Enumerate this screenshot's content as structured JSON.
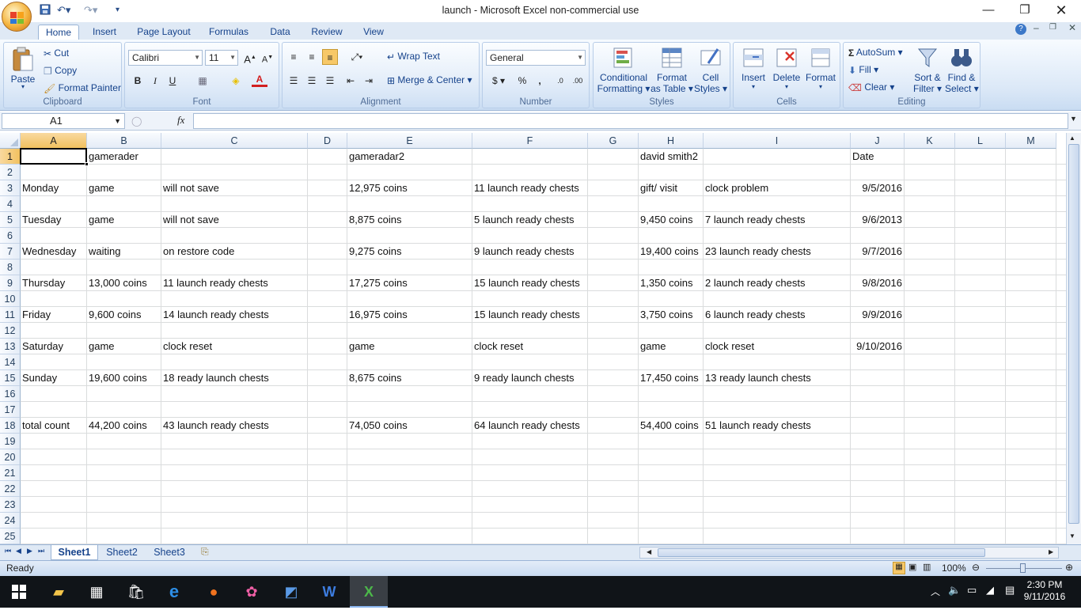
{
  "window": {
    "title": "launch - Microsoft Excel non-commercial use"
  },
  "ribbon": {
    "tabs": [
      "Home",
      "Insert",
      "Page Layout",
      "Formulas",
      "Data",
      "Review",
      "View"
    ],
    "clipboard": {
      "paste": "Paste",
      "cut": "Cut",
      "copy": "Copy",
      "format_painter": "Format Painter",
      "label": "Clipboard"
    },
    "font": {
      "name": "Calibri",
      "size": "11",
      "label": "Font"
    },
    "alignment": {
      "wrap": "Wrap Text",
      "merge": "Merge & Center",
      "label": "Alignment"
    },
    "number": {
      "format": "General",
      "label": "Number"
    },
    "styles": {
      "conditional": [
        "Conditional",
        "Formatting"
      ],
      "format_table": [
        "Format",
        "as Table"
      ],
      "cell_styles": [
        "Cell",
        "Styles"
      ],
      "label": "Styles"
    },
    "cells": {
      "insert": "Insert",
      "delete": "Delete",
      "format": "Format",
      "label": "Cells"
    },
    "editing": {
      "autosum": "AutoSum",
      "fill": "Fill",
      "clear": "Clear",
      "sort": [
        "Sort &",
        "Filter"
      ],
      "find": [
        "Find &",
        "Select"
      ],
      "label": "Editing"
    }
  },
  "formula_bar": {
    "name_box": "A1",
    "fx": "fx",
    "formula": ""
  },
  "grid": {
    "columns": [
      "A",
      "B",
      "C",
      "D",
      "E",
      "F",
      "G",
      "H",
      "I",
      "J",
      "K",
      "L",
      "M"
    ],
    "rows": [
      "1",
      "2",
      "3",
      "4",
      "5",
      "6",
      "7",
      "8",
      "9",
      "10",
      "11",
      "12",
      "13",
      "14",
      "15",
      "16",
      "17",
      "18",
      "19",
      "20",
      "21",
      "22",
      "23",
      "24",
      "25"
    ],
    "active_cell": "A1",
    "cells": {
      "B1": "gamerader",
      "E1": "gameradar2",
      "H1": "david smith2",
      "J1": "Date",
      "A3": "Monday",
      "B3": "game",
      "C3": "will not save",
      "E3": "12,975 coins",
      "F3": "11 launch ready chests",
      "H3": "gift/ visit",
      "I3": "clock problem",
      "J3": "9/5/2016",
      "A5": "Tuesday",
      "B5": "game",
      "C5": "will not save",
      "E5": "8,875 coins",
      "F5": "5 launch ready chests",
      "H5": "9,450 coins",
      "I5": "7 launch ready chests",
      "J5": "9/6/2013",
      "A7": "Wednesday",
      "B7": "waiting",
      "C7": "on restore code",
      "E7": "9,275 coins",
      "F7": "9 launch ready chests",
      "H7": "19,400 coins",
      "I7": "23 launch ready chests",
      "J7": "9/7/2016",
      "A9": "Thursday",
      "B9": "13,000 coins",
      "C9": "11 launch ready chests",
      "E9": "17,275 coins",
      "F9": "15 launch ready chests",
      "H9": "1,350 coins",
      "I9": "2 launch ready chests",
      "J9": "9/8/2016",
      "A11": "Friday",
      "B11": "9,600 coins",
      "C11": "14 launch ready chests",
      "E11": "16,975 coins",
      "F11": "15 launch ready chests",
      "H11": "3,750 coins",
      "I11": "6 launch ready chests",
      "J11": "9/9/2016",
      "A13": "Saturday",
      "B13": "game",
      "C13": "clock reset",
      "E13": "game",
      "F13": "clock reset",
      "H13": "game",
      "I13": "clock reset",
      "J13": "9/10/2016",
      "A15": "Sunday",
      "B15": "19,600 coins",
      "C15": "18 ready launch chests",
      "E15": "8,675 coins",
      "F15": "9 ready launch chests",
      "H15": "17,450 coins",
      "I15": "13 ready launch chests",
      "A18": "total count",
      "B18": "44,200 coins",
      "C18": "43 launch ready chests",
      "E18": "74,050 coins",
      "F18": "64 launch ready chests",
      "H18": " 54,400 coins",
      "I18": "51 launch ready chests"
    },
    "right_aligned": [
      "J3",
      "J5",
      "J7",
      "J9",
      "J11",
      "J13"
    ]
  },
  "sheets": {
    "tabs": [
      "Sheet1",
      "Sheet2",
      "Sheet3"
    ],
    "active": "Sheet1"
  },
  "status": {
    "mode": "Ready",
    "zoom": "100%"
  },
  "taskbar": {
    "time": "2:30 PM",
    "date": "9/11/2016"
  }
}
